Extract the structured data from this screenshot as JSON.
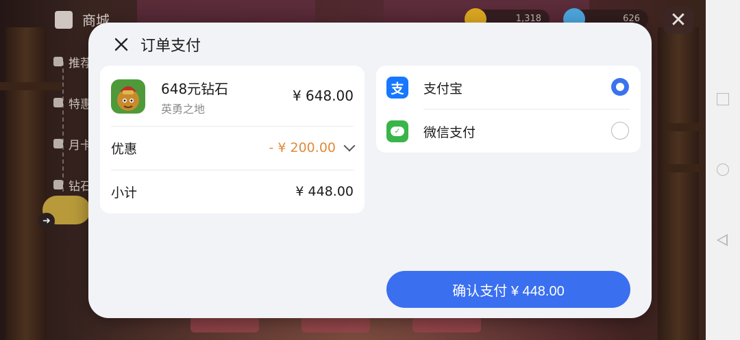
{
  "game": {
    "shop_title": "商城",
    "menu": [
      "推荐",
      "特惠",
      "月卡",
      "钻石"
    ],
    "currency_1": "1,318",
    "currency_2": "626",
    "close_symbol": "✕"
  },
  "dialog": {
    "title": "订单支付",
    "close_symbol": "✕",
    "product": {
      "name": "648元钻石",
      "subtitle": "英勇之地",
      "price": "¥ 648.00"
    },
    "discount": {
      "label": "优惠",
      "value": "- ¥ 200.00"
    },
    "subtotal": {
      "label": "小计",
      "value": "¥ 448.00"
    },
    "payment_methods": [
      {
        "name": "支付宝",
        "icon": "alipay-icon",
        "logo_glyph": "支",
        "color": "#1677ff",
        "selected": true
      },
      {
        "name": "微信支付",
        "icon": "wechat-pay-icon",
        "logo_glyph": "✓",
        "color": "#39b54a",
        "selected": false
      }
    ],
    "confirm_label": "确认支付 ¥ 448.00"
  },
  "colors": {
    "accent": "#3a6ff0",
    "discount": "#e08a3c",
    "alipay": "#1677ff",
    "wechat": "#39b54a"
  }
}
